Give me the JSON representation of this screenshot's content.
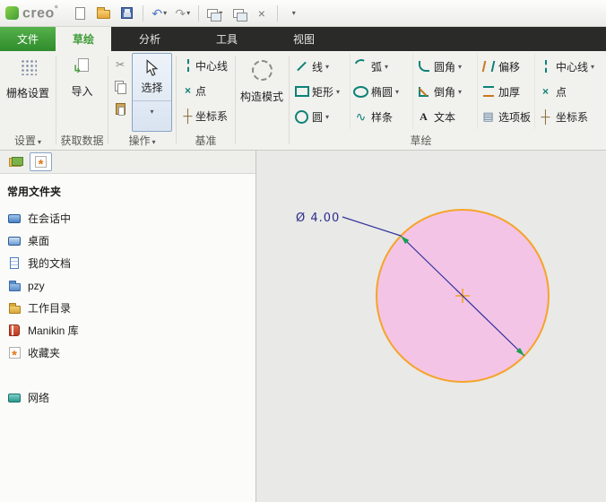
{
  "titlebar": {
    "app_name": "creo",
    "icons": [
      "new-file",
      "open-folder",
      "save",
      "undo",
      "redo",
      "windows",
      "window-arrange",
      "close-window",
      "customize-toolbar"
    ]
  },
  "tabbar": {
    "tabs": [
      {
        "id": "file",
        "label": "文件"
      },
      {
        "id": "sketch",
        "label": "草绘",
        "active": true
      },
      {
        "id": "analysis",
        "label": "分析"
      },
      {
        "id": "tools",
        "label": "工具"
      },
      {
        "id": "view",
        "label": "视图"
      }
    ]
  },
  "ribbon": {
    "grid_settings_btn": "栅格设置",
    "settings_group": "设置",
    "import_btn": "导入",
    "get_data_group": "获取数据",
    "select_btn": "选择",
    "operations_group": "操作",
    "datum": {
      "centerline": "中心线",
      "point": "点",
      "csys": "坐标系",
      "group": "基准"
    },
    "construction_btn": "构造模式",
    "sketch_group": "草绘",
    "tools": {
      "line": "线",
      "arc": "弧",
      "fillet": "圆角",
      "offset": "偏移",
      "centerline": "中心线",
      "rect": "矩形",
      "ellipse": "椭圆",
      "chamfer": "倒角",
      "thicken": "加厚",
      "point": "点",
      "circle": "圆",
      "spline": "样条",
      "text": "文本",
      "palette": "选项板",
      "csys": "坐标系"
    }
  },
  "sidebar": {
    "header": "常用文件夹",
    "items": [
      {
        "label": "在会话中",
        "icon": "in-session-icon"
      },
      {
        "label": "桌面",
        "icon": "desktop-icon"
      },
      {
        "label": "我的文档",
        "icon": "my-documents-icon"
      },
      {
        "label": "pzy",
        "icon": "folder-icon"
      },
      {
        "label": "工作目录",
        "icon": "working-directory-icon"
      },
      {
        "label": "Manikin 库",
        "icon": "library-icon"
      },
      {
        "label": "收藏夹",
        "icon": "favorites-icon"
      },
      {
        "label": "网络",
        "icon": "network-icon"
      }
    ]
  },
  "canvas": {
    "dimension_label": "Ø 4.00",
    "circle_fill": "#f3c4e6",
    "circle_stroke": "#f5a42a",
    "dimension_color": "#32329b",
    "arrow_color": "#18a14d"
  }
}
